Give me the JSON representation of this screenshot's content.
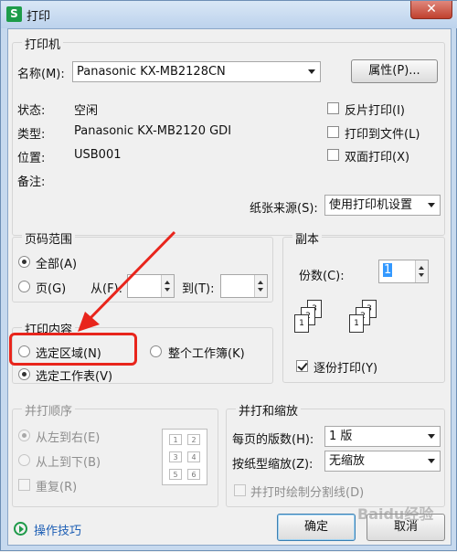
{
  "window": {
    "title": "打印",
    "app_icon": "S",
    "close_label": "✕"
  },
  "printer": {
    "group_label": "打印机",
    "name_label": "名称(M):",
    "name_value": "Panasonic KX-MB2128CN",
    "properties_label": "属性(P)...",
    "status_label": "状态:",
    "status_value": "空闲",
    "type_label": "类型:",
    "type_value": "Panasonic KX-MB2120 GDI",
    "location_label": "位置:",
    "location_value": "USB001",
    "comment_label": "备注:",
    "reverse_label": "反片打印(I)",
    "tofile_label": "打印到文件(L)",
    "duplex_label": "双面打印(X)",
    "paper_source_label": "纸张来源(S):",
    "paper_source_value": "使用打印机设置"
  },
  "page_range": {
    "group_label": "页码范围",
    "all_label": "全部(A)",
    "pages_label": "页(G)",
    "from_label": "从(F):",
    "to_label": "到(T):"
  },
  "print_content": {
    "group_label": "打印内容",
    "selection_label": "选定区域(N)",
    "workbook_label": "整个工作簿(K)",
    "sheet_label": "选定工作表(V)"
  },
  "copies": {
    "group_label": "副本",
    "count_label": "份数(C):",
    "count_value": "1",
    "collate_label": "逐份打印(Y)"
  },
  "print_order": {
    "group_label": "并打顺序",
    "ltr_label": "从左到右(E)",
    "ttb_label": "从上到下(B)",
    "repeat_label": "重复(R)"
  },
  "scaling": {
    "group_label": "并打和缩放",
    "pages_per_sheet_label": "每页的版数(H):",
    "pages_per_sheet_value": "1 版",
    "scale_label": "按纸型缩放(Z):",
    "scale_value": "无缩放",
    "draw_lines_label": "并打时绘制分割线(D)"
  },
  "footer": {
    "tips_label": "操作技巧",
    "ok_label": "确定",
    "cancel_label": "取消"
  },
  "order_diagram": [
    "1",
    "2",
    "3",
    "4",
    "5",
    "6"
  ],
  "collate_diagram": [
    "1",
    "2",
    "3",
    "1",
    "2",
    "3"
  ],
  "watermark": "Baidu经验"
}
